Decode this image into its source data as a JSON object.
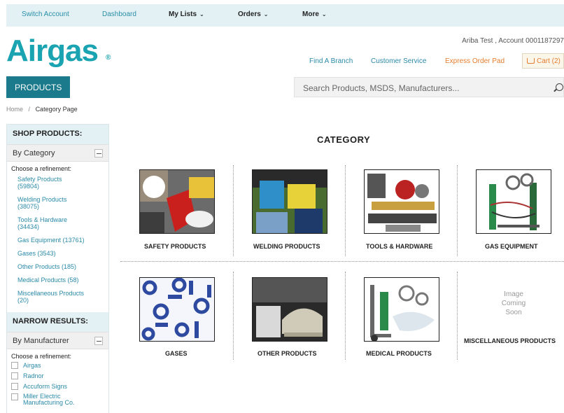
{
  "topnav": {
    "switch_account": "Switch Account",
    "dashboard": "Dashboard",
    "my_lists": "My Lists",
    "orders": "Orders",
    "more": "More"
  },
  "header": {
    "logo": "Airgas",
    "logo_reg": "®",
    "account": "Ariba Test , Account 0001187297",
    "find_branch": "Find A Branch",
    "customer_service": "Customer Service",
    "express_order_pad": "Express Order Pad",
    "cart": "Cart (2)"
  },
  "products_button": "PRODUCTS",
  "search": {
    "placeholder": "Search Products, MSDS, Manufacturers..."
  },
  "breadcrumb": {
    "home": "Home",
    "sep": "/",
    "current": "Category Page"
  },
  "sidebar": {
    "shop_heading": "SHOP PRODUCTS:",
    "by_category": "By Category",
    "choose": "Choose a refinement:",
    "categories": [
      {
        "name": "Safety Products",
        "count": "(59804)"
      },
      {
        "name": "Welding Products",
        "count": "(38075)"
      },
      {
        "name": "Tools & Hardware",
        "count": "(34434)"
      },
      {
        "name": "Gas Equipment",
        "count": "(13761)"
      },
      {
        "name": "Gases",
        "count": "(3543)"
      },
      {
        "name": "Other Products",
        "count": "(185)"
      },
      {
        "name": "Medical Products",
        "count": "(58)"
      },
      {
        "name": "Miscellaneous Products",
        "count": "(20)"
      }
    ],
    "narrow_heading": "NARROW RESULTS:",
    "by_manufacturer": "By Manufacturer",
    "choose2": "Choose a refinement:",
    "manufacturers": [
      "Airgas",
      "Radnor",
      "Accuform Signs",
      "Miller Electric Manufacturing Co."
    ]
  },
  "main": {
    "title": "CATEGORY",
    "categories": [
      {
        "label": "SAFETY PRODUCTS",
        "icon": "safety-products-image"
      },
      {
        "label": "WELDING PRODUCTS",
        "icon": "welding-products-image"
      },
      {
        "label": "TOOLS & HARDWARE",
        "icon": "tools-hardware-image"
      },
      {
        "label": "GAS EQUIPMENT",
        "icon": "gas-equipment-image"
      },
      {
        "label": "GASES",
        "icon": "gases-image"
      },
      {
        "label": "OTHER PRODUCTS",
        "icon": "other-products-image"
      },
      {
        "label": "MEDICAL PRODUCTS",
        "icon": "medical-products-image"
      },
      {
        "label": "MISCELLANEOUS PRODUCTS",
        "icon": "image-coming-soon-placeholder"
      }
    ],
    "coming_soon": [
      "Image",
      "Coming",
      "Soon"
    ]
  },
  "colors": {
    "brand": "#1aa3b0",
    "nav_bg": "#e3f1f4",
    "button": "#1b7a8c",
    "link": "#2a8aa8",
    "accent_orange": "#e57c2e"
  }
}
